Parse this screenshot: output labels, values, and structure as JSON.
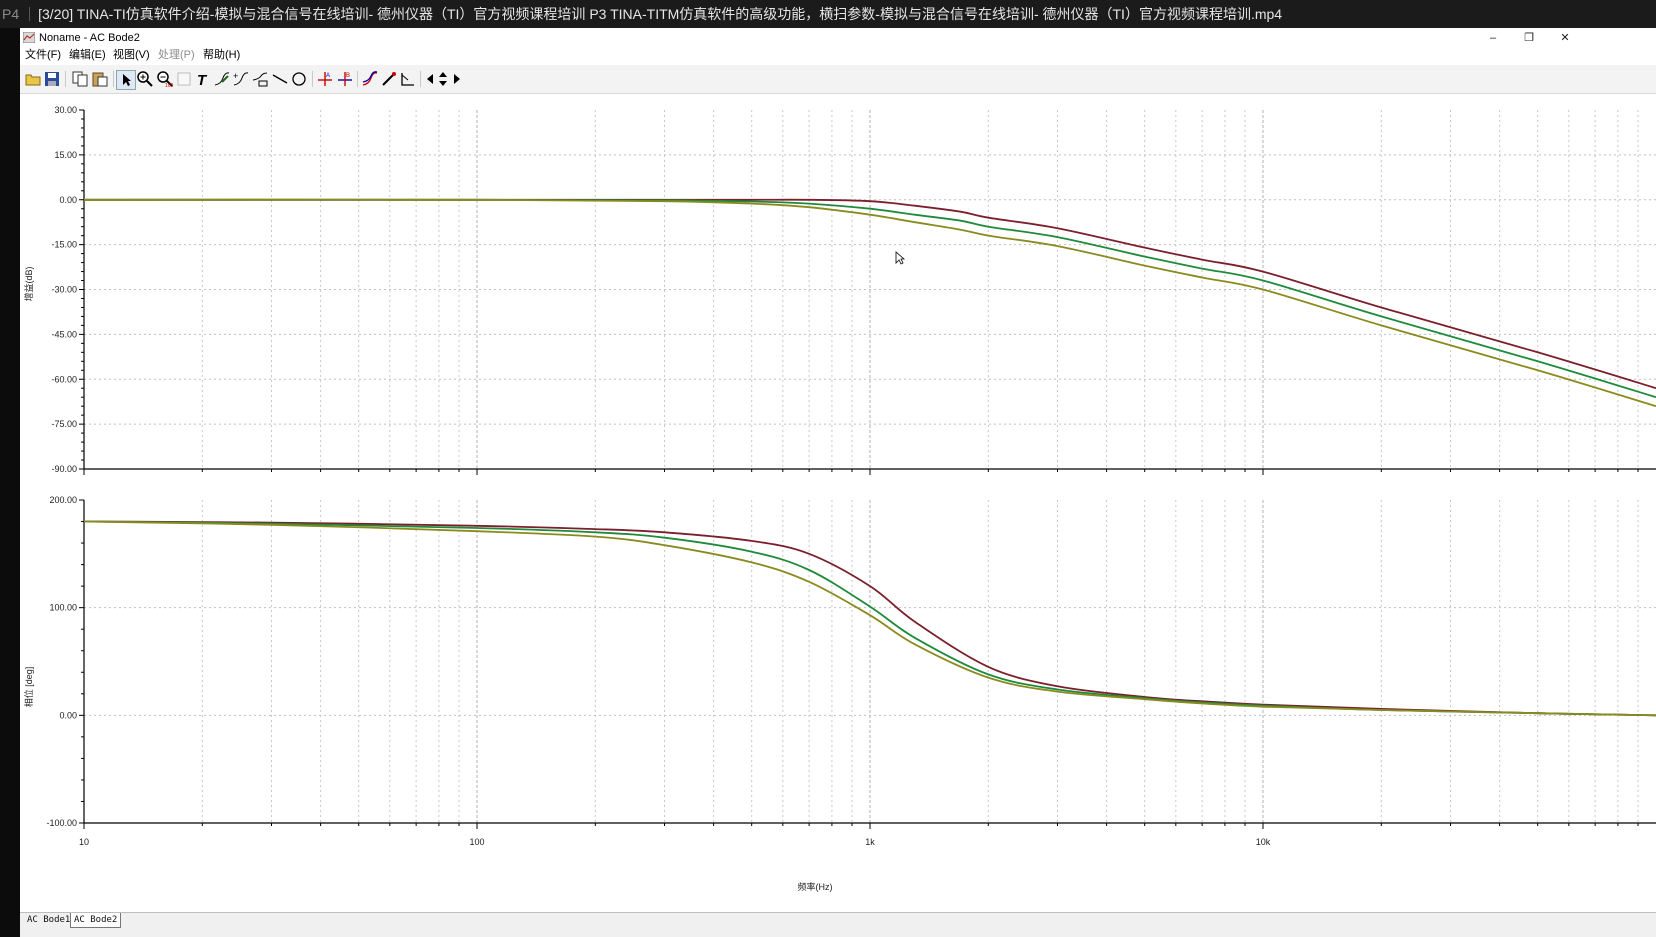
{
  "player": {
    "episode_label": "P4",
    "title": "[3/20] TINA-TI仿真软件介绍-模拟与混合信号在线培训- 德州仪器（TI）官方视频课程培训 P3 TINA-TITM仿真软件的高级功能，横扫参数-模拟与混合信号在线培训- 德州仪器（TI）官方视频课程培训.mp4"
  },
  "window": {
    "title": "Noname - AC Bode2",
    "minimize": "–",
    "restore": "❐",
    "close": "✕"
  },
  "menu": [
    {
      "label": "文件(F)",
      "enabled": true
    },
    {
      "label": "编辑(E)",
      "enabled": true
    },
    {
      "label": "视图(V)",
      "enabled": true
    },
    {
      "label": "处理(P)",
      "enabled": false
    },
    {
      "label": "帮助(H)",
      "enabled": true
    }
  ],
  "toolbar_icons": [
    "open-icon",
    "save-icon",
    "copy-icon",
    "paste-icon",
    "pointer-icon",
    "zoom-in-icon",
    "zoom-out-icon",
    "blank-icon",
    "text-icon",
    "curve-edit-icon",
    "curve-add-icon",
    "curve-delete-icon",
    "line-icon",
    "circle-icon",
    "cursor-a-icon",
    "cursor-b-icon",
    "data-marker-icon",
    "pen-icon",
    "axis-icon",
    "arrow-left-icon",
    "arrow-updown-icon",
    "arrow-right-icon"
  ],
  "tabs": [
    {
      "label": "AC Bode1",
      "active": false
    },
    {
      "label": "AC Bode2",
      "active": true
    }
  ],
  "chart_data": [
    {
      "type": "line",
      "id": "gain",
      "ylabel": "增益(dB)",
      "ylim": [
        -90,
        30
      ],
      "yticks": [
        "30.00",
        "15.00",
        "0.00",
        "-15.00",
        "-30.00",
        "-45.00",
        "-60.00",
        "-75.00",
        "-90.00"
      ],
      "ytick_values": [
        30,
        15,
        0,
        -15,
        -30,
        -45,
        -60,
        -75,
        -90
      ],
      "xscale": "log",
      "xlim": [
        10,
        100000
      ],
      "grid": true,
      "series": [
        {
          "color": "#7a1f2b",
          "x": [
            10,
            100,
            300,
            500,
            700,
            1000,
            1300,
            1700,
            2000,
            3000,
            5000,
            7000,
            10000,
            20000,
            50000,
            100000
          ],
          "y": [
            0,
            0,
            0,
            0,
            0,
            -0.5,
            -2,
            -4,
            -6,
            -9.5,
            -16,
            -20,
            -24,
            -36,
            -51,
            -63
          ]
        },
        {
          "color": "#1f8a3a",
          "x": [
            10,
            100,
            300,
            500,
            700,
            1000,
            1300,
            1700,
            2000,
            3000,
            5000,
            7000,
            10000,
            20000,
            50000,
            100000
          ],
          "y": [
            0,
            0,
            -0.2,
            -0.6,
            -1.3,
            -3,
            -5,
            -7,
            -9,
            -12.5,
            -19,
            -23,
            -27,
            -39,
            -54,
            -66
          ]
        },
        {
          "color": "#8a8a1f",
          "x": [
            10,
            100,
            300,
            500,
            700,
            1000,
            1300,
            1700,
            2000,
            3000,
            5000,
            7000,
            10000,
            20000,
            50000,
            100000
          ],
          "y": [
            0,
            0,
            -0.5,
            -1.3,
            -2.5,
            -5,
            -7.5,
            -10,
            -12,
            -15.5,
            -22,
            -26,
            -30,
            -42,
            -57,
            -69
          ]
        }
      ]
    },
    {
      "type": "line",
      "id": "phase",
      "ylabel": "相位 [deg]",
      "xlabel": "频率(Hz)",
      "ylim": [
        -100,
        200
      ],
      "yticks": [
        "200.00",
        "100.00",
        "0.00",
        "-100.00"
      ],
      "ytick_values": [
        200,
        100,
        0,
        -100
      ],
      "xscale": "log",
      "xlim": [
        10,
        100000
      ],
      "xticks": [
        "10",
        "100",
        "1k",
        "10k"
      ],
      "xtick_values": [
        10,
        100,
        1000,
        10000
      ],
      "grid": true,
      "series": [
        {
          "color": "#7a1f2b",
          "x": [
            10,
            30,
            100,
            200,
            300,
            500,
            700,
            1000,
            1300,
            2000,
            3000,
            5000,
            7000,
            10000,
            20000,
            50000,
            100000
          ],
          "y": [
            180,
            179,
            176,
            173,
            170,
            162,
            150,
            120,
            87,
            45,
            27,
            17,
            13,
            10,
            6,
            2,
            0
          ]
        },
        {
          "color": "#1f8a3a",
          "x": [
            10,
            30,
            100,
            200,
            300,
            500,
            700,
            1000,
            1300,
            2000,
            3000,
            5000,
            7000,
            10000,
            20000,
            50000,
            100000
          ],
          "y": [
            180,
            178,
            174,
            170,
            165,
            152,
            135,
            101,
            72,
            38,
            24,
            16,
            12,
            9,
            5,
            2,
            0
          ]
        },
        {
          "color": "#8a8a1f",
          "x": [
            10,
            30,
            100,
            200,
            300,
            500,
            700,
            1000,
            1300,
            2000,
            3000,
            5000,
            7000,
            10000,
            20000,
            50000,
            100000
          ],
          "y": [
            180,
            177,
            171,
            166,
            158,
            142,
            124,
            93,
            66,
            35,
            22,
            15,
            11,
            8,
            5,
            2,
            0
          ]
        }
      ]
    }
  ]
}
